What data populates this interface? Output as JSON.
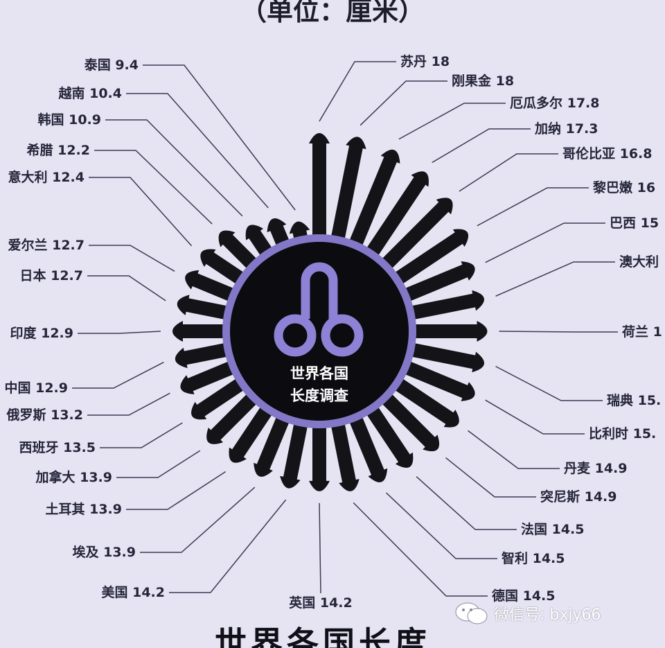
{
  "header": {
    "unit": "（单位：厘米）"
  },
  "center_label": {
    "line1": "世界各国",
    "line2": "长度调查"
  },
  "watermark": {
    "text": "微信号: bxjy66",
    "icon": "wechat-icon"
  },
  "footer": {
    "title": "世界各国长度"
  },
  "colors": {
    "background": "#e6e4f2",
    "spike": "#131318",
    "hub_ring": "#8378c7",
    "hub_fill": "#0b0b10",
    "text": "#25253a"
  },
  "chart_data": {
    "type": "radial-bar",
    "unit": "厘米",
    "items": [
      {
        "country": "苏丹",
        "value": 18,
        "label": "苏丹 18"
      },
      {
        "country": "刚果金",
        "value": 18,
        "label": "刚果金 18"
      },
      {
        "country": "厄瓜多尔",
        "value": 17.8,
        "label": "厄瓜多尔 17.8"
      },
      {
        "country": "加纳",
        "value": 17.3,
        "label": "加纳 17.3"
      },
      {
        "country": "哥伦比亚",
        "value": 16.8,
        "label": "哥伦比亚 16.8"
      },
      {
        "country": "黎巴嫩",
        "value": 16,
        "label": "黎巴嫩 16"
      },
      {
        "country": "巴西",
        "value": 15,
        "label": "巴西 15"
      },
      {
        "country": "澳大利",
        "value": null,
        "label": "澳大利"
      },
      {
        "country": "荷兰",
        "value": null,
        "label": "荷兰 1"
      },
      {
        "country": "瑞典",
        "value": 15,
        "label": "瑞典 15."
      },
      {
        "country": "比利时",
        "value": 15,
        "label": "比利时 15."
      },
      {
        "country": "丹麦",
        "value": 14.9,
        "label": "丹麦 14.9"
      },
      {
        "country": "突尼斯",
        "value": 14.9,
        "label": "突尼斯 14.9"
      },
      {
        "country": "法国",
        "value": 14.5,
        "label": "法国 14.5"
      },
      {
        "country": "智利",
        "value": 14.5,
        "label": "智利 14.5"
      },
      {
        "country": "德国",
        "value": 14.5,
        "label": "德国 14.5"
      },
      {
        "country": "英国",
        "value": 14.2,
        "label": "英国 14.2"
      },
      {
        "country": "美国",
        "value": 14.2,
        "label": "美国 14.2"
      },
      {
        "country": "埃及",
        "value": 13.9,
        "label": "埃及 13.9"
      },
      {
        "country": "土耳其",
        "value": 13.9,
        "label": "土耳其 13.9"
      },
      {
        "country": "加拿大",
        "value": 13.9,
        "label": "加拿大 13.9"
      },
      {
        "country": "西班牙",
        "value": 13.5,
        "label": "西班牙 13.5"
      },
      {
        "country": "俄罗斯",
        "value": 13.2,
        "label": "俄罗斯 13.2"
      },
      {
        "country": "中国",
        "value": 12.9,
        "label": "中国 12.9"
      },
      {
        "country": "印度",
        "value": 12.9,
        "label": "印度 12.9"
      },
      {
        "country": "日本",
        "value": 12.7,
        "label": "日本 12.7"
      },
      {
        "country": "爱尔兰",
        "value": 12.7,
        "label": "爱尔兰 12.7"
      },
      {
        "country": "意大利",
        "value": 12.4,
        "label": "意大利 12.4"
      },
      {
        "country": "希腊",
        "value": 12.2,
        "label": "希腊 12.2"
      },
      {
        "country": "韩国",
        "value": 10.9,
        "label": "韩国 10.9"
      },
      {
        "country": "越南",
        "value": 10.4,
        "label": "越南 10.4"
      },
      {
        "country": "泰国",
        "value": 9.4,
        "label": "泰国 9.4"
      }
    ]
  }
}
